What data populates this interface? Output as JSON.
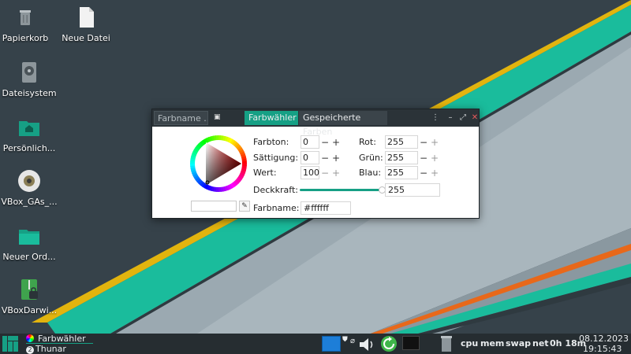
{
  "desktop": {
    "icons": [
      {
        "label": "Papierkorb",
        "icon": "trash-icon"
      },
      {
        "label": "Neue Datei",
        "icon": "file-icon"
      },
      {
        "label": "Dateisystem",
        "icon": "drive-icon"
      },
      {
        "label": "Persönlich...",
        "icon": "home-folder-icon"
      },
      {
        "label": "VBox_GAs_...",
        "icon": "cd-icon"
      },
      {
        "label": "Neuer Ord...",
        "icon": "folder-icon"
      },
      {
        "label": "VBoxDarwi...",
        "icon": "archive-icon"
      }
    ]
  },
  "window": {
    "name_placeholder": "Farbname ...",
    "tabs": [
      "Farbwähler",
      "Gespeicherte Farben"
    ],
    "active_tab": "Farbwähler",
    "fields": {
      "hue": {
        "label": "Farbton:",
        "value": "0"
      },
      "saturation": {
        "label": "Sättigung:",
        "value": "0"
      },
      "value": {
        "label": "Wert:",
        "value": "100"
      },
      "red": {
        "label": "Rot:",
        "value": "255"
      },
      "green": {
        "label": "Grün:",
        "value": "255"
      },
      "blue": {
        "label": "Blau:",
        "value": "255"
      },
      "opacity": {
        "label": "Deckkraft:",
        "value": "255",
        "level": 1.0
      },
      "name": {
        "label": "Farbname:",
        "value": "#ffffff"
      }
    },
    "minus": "−",
    "plus": "+",
    "selected_color": "#ffffff"
  },
  "taskbar": {
    "tasks": [
      {
        "label": "Farbwähler"
      },
      {
        "label": "Thunar",
        "badge": "2"
      }
    ],
    "tray": [
      "cpu",
      "mem",
      "swap",
      "net"
    ],
    "uptime": "0h 18m",
    "date": "08.12.2023",
    "time": "19:15:43"
  },
  "colors": {
    "accent": "#16a085",
    "wallpaper_dark": "#36424a",
    "stripe_yellow": "#e2b40e",
    "stripe_teal": "#1abc9c",
    "stripe_orange": "#e8681a"
  }
}
